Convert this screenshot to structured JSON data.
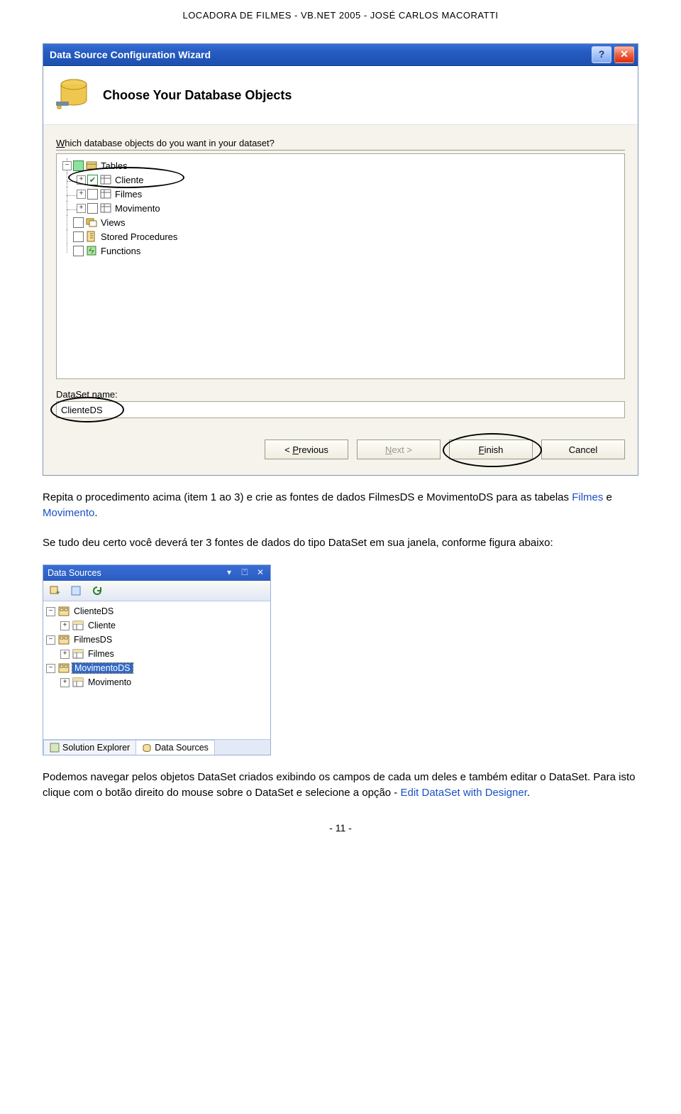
{
  "header": "LOCADORA DE FILMES  -  VB.NET 2005 - JOSÉ CARLOS MACORATTI",
  "wizard": {
    "title_bar": "Data Source Configuration Wizard",
    "heading": "Choose Your Database Objects",
    "prompt_pre": "W",
    "prompt_rest": "hich database objects do you want in your dataset?",
    "tree": {
      "tables": "Tables",
      "items": [
        {
          "label": "Cliente",
          "checked": true
        },
        {
          "label": "Filmes",
          "checked": false
        },
        {
          "label": "Movimento",
          "checked": false
        }
      ],
      "views": "Views",
      "sp": "Stored Procedures",
      "fn": "Functions"
    },
    "dataset_label_pre": "DataSet n",
    "dataset_label_u": "a",
    "dataset_label_post": "me:",
    "dataset_value": "ClienteDS",
    "buttons": {
      "previous_pre": "< ",
      "previous_u": "P",
      "previous_post": "revious",
      "next_pre": "",
      "next_u": "N",
      "next_post": "ext >",
      "finish_pre": "",
      "finish_u": "F",
      "finish_post": "inish",
      "cancel": "Cancel"
    }
  },
  "paras": {
    "p1_a": "Repita o procedimento acima (item 1 ao 3) e crie as fontes de dados FilmesDS e MovimentoDS para as tabelas ",
    "p1_b": "Filmes",
    "p1_c": " e ",
    "p1_d": "Movimento",
    "p1_e": ".",
    "p2": "Se tudo deu certo você deverá ter 3 fontes de dados do tipo DataSet em sua janela, conforme figura abaixo:",
    "p3_a": "Podemos navegar pelos objetos DataSet criados exibindo os campos de cada um deles e também editar o DataSet. Para isto clique com o botão direito do mouse sobre o DataSet e selecione a opção - ",
    "p3_b": "Edit DataSet with Designer",
    "p3_c": "."
  },
  "dsPanel": {
    "title": "Data Sources",
    "tree": [
      {
        "label": "ClienteDS",
        "type": "ds",
        "children": [
          {
            "label": "Cliente",
            "type": "table"
          }
        ]
      },
      {
        "label": "FilmesDS",
        "type": "ds",
        "children": [
          {
            "label": "Filmes",
            "type": "table"
          }
        ]
      },
      {
        "label": "MovimentoDS",
        "type": "ds",
        "selected": true,
        "children": [
          {
            "label": "Movimento",
            "type": "table"
          }
        ]
      }
    ],
    "tabs": {
      "se": "Solution Explorer",
      "ds": "Data Sources"
    }
  },
  "footer": "- 11 -"
}
